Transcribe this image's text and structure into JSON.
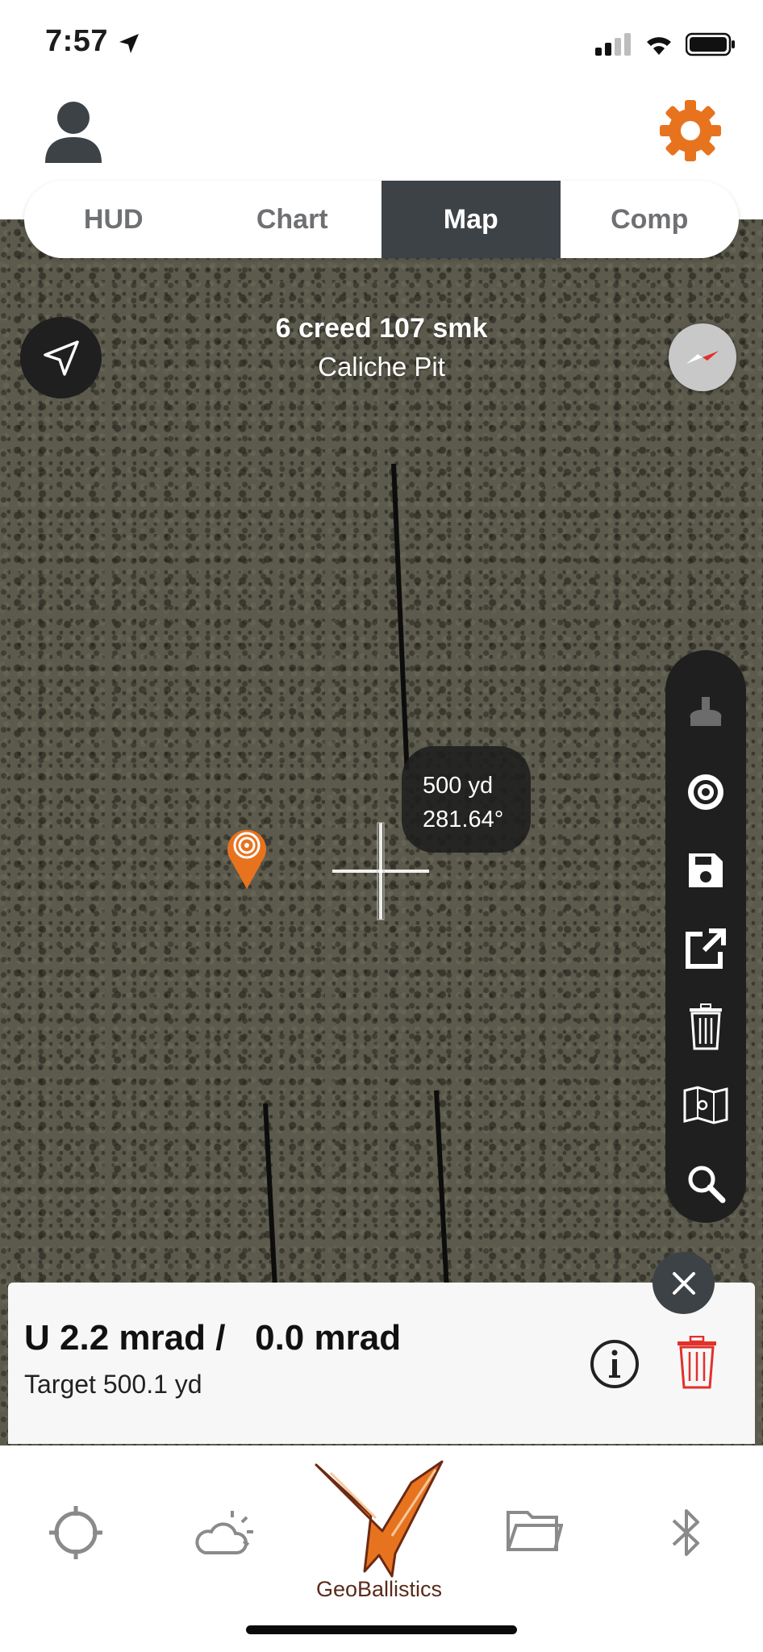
{
  "status": {
    "time": "7:57"
  },
  "tabs": [
    {
      "label": "HUD",
      "active": false
    },
    {
      "label": "Chart",
      "active": false
    },
    {
      "label": "Map",
      "active": true
    },
    {
      "label": "Comp",
      "active": false
    }
  ],
  "map": {
    "title": "6 creed 107 smk",
    "subtitle": "Caliche Pit",
    "range_label": "500 yd",
    "bearing_label": "281.64°"
  },
  "toolbar": {
    "items": [
      "shooter-icon",
      "target-icon",
      "save-icon",
      "share-icon",
      "trash-icon",
      "map-layers-icon",
      "search-icon"
    ]
  },
  "result": {
    "adjustment": "U 2.2 mrad /   0.0 mrad",
    "target": "Target 500.1 yd"
  },
  "bottom_nav": {
    "brand": "GeoBallistics",
    "items": [
      "crosshair-icon",
      "weather-icon",
      "geoballistics-logo",
      "folder-icon",
      "bluetooth-icon"
    ]
  },
  "colors": {
    "accent": "#e8731f",
    "dark": "#3d4247",
    "danger": "#e0312b"
  }
}
